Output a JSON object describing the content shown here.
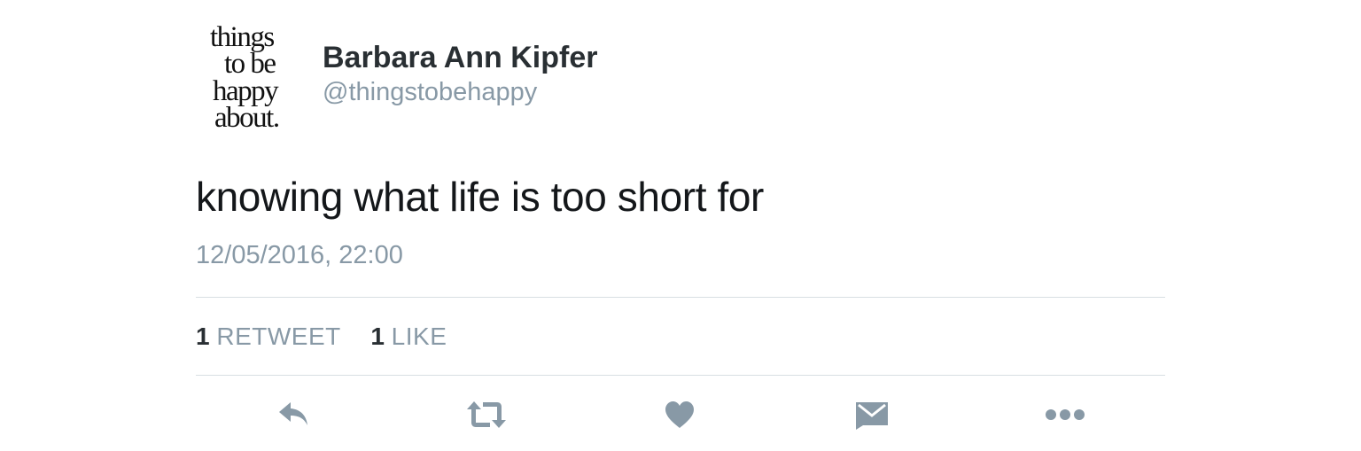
{
  "user": {
    "display_name": "Barbara Ann Kipfer",
    "handle": "@thingstobehappy",
    "avatar_lines": [
      "things",
      "to be",
      "happy",
      "about."
    ]
  },
  "tweet": {
    "text": "knowing what life is too short for",
    "timestamp": "12/05/2016, 22:00"
  },
  "stats": {
    "retweet_count": "1",
    "retweet_label": "RETWEET",
    "like_count": "1",
    "like_label": "LIKE"
  },
  "actions": {
    "icons": [
      "reply-icon",
      "retweet-icon",
      "heart-icon",
      "envelope-icon",
      "more-icon"
    ]
  },
  "colors": {
    "primary_text": "#14171a",
    "secondary_text": "#8899a6",
    "icon": "#8899a6",
    "divider": "#d8dee3"
  }
}
